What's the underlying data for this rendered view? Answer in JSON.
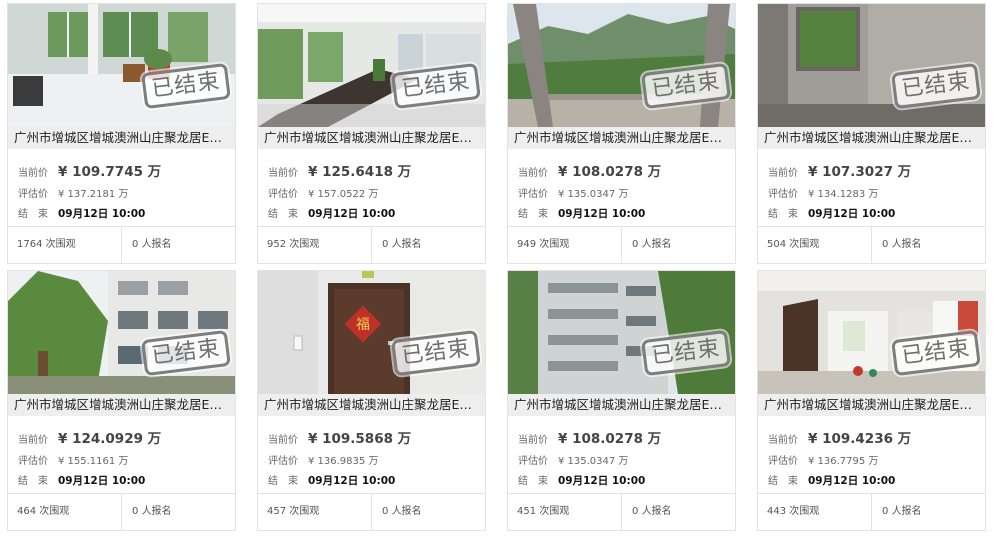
{
  "status_stamp": "已结束",
  "labels": {
    "current_price": "当前价",
    "estimate": "评估价",
    "end": "结　束",
    "views_suffix": "次围观",
    "signup_suffix": "人报名"
  },
  "cards": [
    {
      "title": "广州市增城区增城澳洲山庄聚龙居EA1…",
      "current_price": "¥ 109.7745 万",
      "estimate": "¥ 137.2181 万",
      "end_time": "09月12日 10:00",
      "views": "1764",
      "signups": "0",
      "photo": "office-lobby"
    },
    {
      "title": "广州市增城区增城澳洲山庄聚龙居EA1…",
      "current_price": "¥ 125.6418 万",
      "estimate": "¥ 157.0522 万",
      "end_time": "09月12日 10:00",
      "views": "952",
      "signups": "0",
      "photo": "meeting-room"
    },
    {
      "title": "广州市增城区增城澳洲山庄聚龙居EA1…",
      "current_price": "¥ 108.0278 万",
      "estimate": "¥ 135.0347 万",
      "end_time": "09月12日 10:00",
      "views": "949",
      "signups": "0",
      "photo": "balcony-view"
    },
    {
      "title": "广州市增城区增城澳洲山庄聚龙居EA1…",
      "current_price": "¥ 107.3027 万",
      "estimate": "¥ 134.1283 万",
      "end_time": "09月12日 10:00",
      "views": "504",
      "signups": "0",
      "photo": "bare-room"
    },
    {
      "title": "广州市增城区增城澳洲山庄聚龙居EA1…",
      "current_price": "¥ 124.0929 万",
      "estimate": "¥ 155.1161 万",
      "end_time": "09月12日 10:00",
      "views": "464",
      "signups": "0",
      "photo": "building-exterior"
    },
    {
      "title": "广州市增城区增城澳洲山庄聚龙居EA1…",
      "current_price": "¥ 109.5868 万",
      "estimate": "¥ 136.9835 万",
      "end_time": "09月12日 10:00",
      "views": "457",
      "signups": "0",
      "photo": "apartment-door"
    },
    {
      "title": "广州市增城区增城澳洲山庄聚龙居EA1…",
      "current_price": "¥ 108.0278 万",
      "estimate": "¥ 135.0347 万",
      "end_time": "09月12日 10:00",
      "views": "451",
      "signups": "0",
      "photo": "apartment-block"
    },
    {
      "title": "广州市增城区增城澳洲山庄聚龙居EA1…",
      "current_price": "¥ 109.4236 万",
      "estimate": "¥ 136.7795 万",
      "end_time": "09月12日 10:00",
      "views": "443",
      "signups": "0",
      "photo": "interior-hall"
    }
  ]
}
